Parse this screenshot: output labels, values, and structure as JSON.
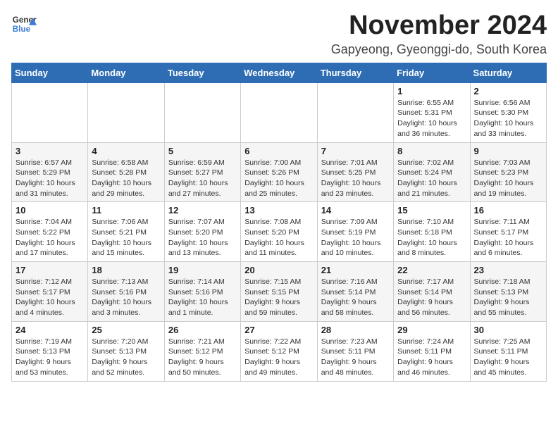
{
  "logo": {
    "line1": "General",
    "line2": "Blue"
  },
  "title": "November 2024",
  "location": "Gapyeong, Gyeonggi-do, South Korea",
  "days_of_week": [
    "Sunday",
    "Monday",
    "Tuesday",
    "Wednesday",
    "Thursday",
    "Friday",
    "Saturday"
  ],
  "weeks": [
    [
      {
        "day": "",
        "info": ""
      },
      {
        "day": "",
        "info": ""
      },
      {
        "day": "",
        "info": ""
      },
      {
        "day": "",
        "info": ""
      },
      {
        "day": "",
        "info": ""
      },
      {
        "day": "1",
        "info": "Sunrise: 6:55 AM\nSunset: 5:31 PM\nDaylight: 10 hours and 36 minutes."
      },
      {
        "day": "2",
        "info": "Sunrise: 6:56 AM\nSunset: 5:30 PM\nDaylight: 10 hours and 33 minutes."
      }
    ],
    [
      {
        "day": "3",
        "info": "Sunrise: 6:57 AM\nSunset: 5:29 PM\nDaylight: 10 hours and 31 minutes."
      },
      {
        "day": "4",
        "info": "Sunrise: 6:58 AM\nSunset: 5:28 PM\nDaylight: 10 hours and 29 minutes."
      },
      {
        "day": "5",
        "info": "Sunrise: 6:59 AM\nSunset: 5:27 PM\nDaylight: 10 hours and 27 minutes."
      },
      {
        "day": "6",
        "info": "Sunrise: 7:00 AM\nSunset: 5:26 PM\nDaylight: 10 hours and 25 minutes."
      },
      {
        "day": "7",
        "info": "Sunrise: 7:01 AM\nSunset: 5:25 PM\nDaylight: 10 hours and 23 minutes."
      },
      {
        "day": "8",
        "info": "Sunrise: 7:02 AM\nSunset: 5:24 PM\nDaylight: 10 hours and 21 minutes."
      },
      {
        "day": "9",
        "info": "Sunrise: 7:03 AM\nSunset: 5:23 PM\nDaylight: 10 hours and 19 minutes."
      }
    ],
    [
      {
        "day": "10",
        "info": "Sunrise: 7:04 AM\nSunset: 5:22 PM\nDaylight: 10 hours and 17 minutes."
      },
      {
        "day": "11",
        "info": "Sunrise: 7:06 AM\nSunset: 5:21 PM\nDaylight: 10 hours and 15 minutes."
      },
      {
        "day": "12",
        "info": "Sunrise: 7:07 AM\nSunset: 5:20 PM\nDaylight: 10 hours and 13 minutes."
      },
      {
        "day": "13",
        "info": "Sunrise: 7:08 AM\nSunset: 5:20 PM\nDaylight: 10 hours and 11 minutes."
      },
      {
        "day": "14",
        "info": "Sunrise: 7:09 AM\nSunset: 5:19 PM\nDaylight: 10 hours and 10 minutes."
      },
      {
        "day": "15",
        "info": "Sunrise: 7:10 AM\nSunset: 5:18 PM\nDaylight: 10 hours and 8 minutes."
      },
      {
        "day": "16",
        "info": "Sunrise: 7:11 AM\nSunset: 5:17 PM\nDaylight: 10 hours and 6 minutes."
      }
    ],
    [
      {
        "day": "17",
        "info": "Sunrise: 7:12 AM\nSunset: 5:17 PM\nDaylight: 10 hours and 4 minutes."
      },
      {
        "day": "18",
        "info": "Sunrise: 7:13 AM\nSunset: 5:16 PM\nDaylight: 10 hours and 3 minutes."
      },
      {
        "day": "19",
        "info": "Sunrise: 7:14 AM\nSunset: 5:16 PM\nDaylight: 10 hours and 1 minute."
      },
      {
        "day": "20",
        "info": "Sunrise: 7:15 AM\nSunset: 5:15 PM\nDaylight: 9 hours and 59 minutes."
      },
      {
        "day": "21",
        "info": "Sunrise: 7:16 AM\nSunset: 5:14 PM\nDaylight: 9 hours and 58 minutes."
      },
      {
        "day": "22",
        "info": "Sunrise: 7:17 AM\nSunset: 5:14 PM\nDaylight: 9 hours and 56 minutes."
      },
      {
        "day": "23",
        "info": "Sunrise: 7:18 AM\nSunset: 5:13 PM\nDaylight: 9 hours and 55 minutes."
      }
    ],
    [
      {
        "day": "24",
        "info": "Sunrise: 7:19 AM\nSunset: 5:13 PM\nDaylight: 9 hours and 53 minutes."
      },
      {
        "day": "25",
        "info": "Sunrise: 7:20 AM\nSunset: 5:13 PM\nDaylight: 9 hours and 52 minutes."
      },
      {
        "day": "26",
        "info": "Sunrise: 7:21 AM\nSunset: 5:12 PM\nDaylight: 9 hours and 50 minutes."
      },
      {
        "day": "27",
        "info": "Sunrise: 7:22 AM\nSunset: 5:12 PM\nDaylight: 9 hours and 49 minutes."
      },
      {
        "day": "28",
        "info": "Sunrise: 7:23 AM\nSunset: 5:11 PM\nDaylight: 9 hours and 48 minutes."
      },
      {
        "day": "29",
        "info": "Sunrise: 7:24 AM\nSunset: 5:11 PM\nDaylight: 9 hours and 46 minutes."
      },
      {
        "day": "30",
        "info": "Sunrise: 7:25 AM\nSunset: 5:11 PM\nDaylight: 9 hours and 45 minutes."
      }
    ]
  ]
}
